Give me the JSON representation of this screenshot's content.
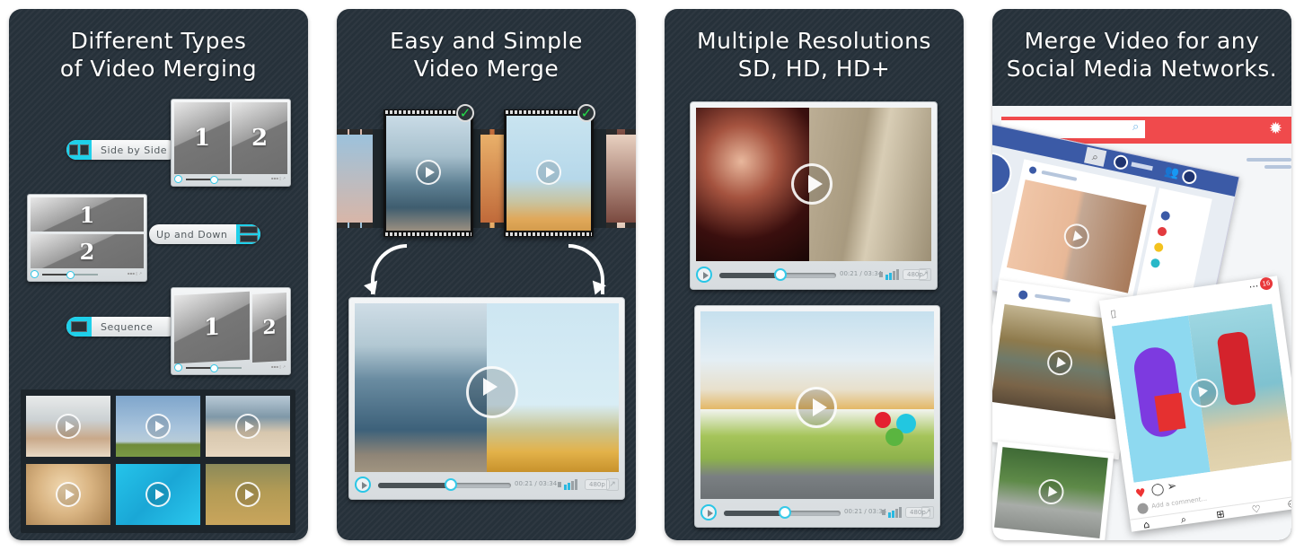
{
  "cards": [
    {
      "title": "Different Types\nof Video Merging",
      "modes": [
        {
          "label": "Side by Side",
          "cells": [
            "1",
            "2"
          ]
        },
        {
          "label": "Up and Down",
          "cells": [
            "1",
            "2"
          ]
        },
        {
          "label": "Sequence",
          "cells": [
            "1",
            "2"
          ]
        }
      ],
      "gallery_count": 6
    },
    {
      "title": "Easy and Simple\nVideo Merge",
      "player": {
        "time": "00:21 / 03:34",
        "quality": "480p",
        "progress": 0.55,
        "volume_level": 2
      }
    },
    {
      "title": "Multiple Resolutions\nSD, HD, HD+",
      "players": [
        {
          "time": "00:21 / 03:34",
          "quality": "480p",
          "progress": 0.52,
          "volume_level": 2
        },
        {
          "time": "00:21 / 03:34",
          "quality": "480p",
          "progress": 0.52,
          "volume_level": 2
        }
      ]
    },
    {
      "title": "Merge Video for any\nSocial Media Networks.",
      "insta": {
        "comment_placeholder": "Add a comment...",
        "notification_count": "16"
      }
    }
  ],
  "colors": {
    "card_bg": "#26313a",
    "accent": "#1fd0ea",
    "check": "#23e04a",
    "fb_blue": "#3b5aa6",
    "red_bar": "#f04a4c"
  }
}
